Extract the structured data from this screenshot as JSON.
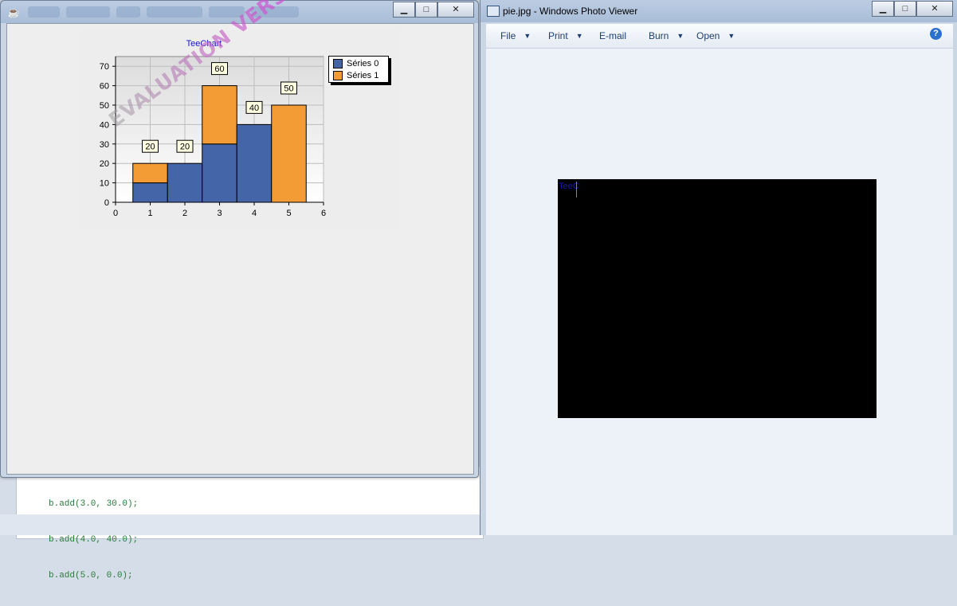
{
  "background_editor": {
    "code_lines": [
      "b.add(3.0, 30.0);",
      "b.add(4.0, 40.0);",
      "b.add(5.0, 0.0);"
    ]
  },
  "java_window": {
    "minimize_glyph": "▁",
    "maximize_glyph": "□",
    "close_glyph": "✕"
  },
  "chart": {
    "title": "TeeChart",
    "watermark": "EVALUATION VERSION",
    "legend": [
      "Séries 0",
      "Séries 1"
    ]
  },
  "chart_data": {
    "type": "bar",
    "stacked": true,
    "title": "TeeChart",
    "x": [
      1,
      2,
      3,
      4,
      5
    ],
    "series": [
      {
        "name": "Séries 0",
        "values": [
          10,
          20,
          30,
          40,
          0
        ],
        "color": "#4466a8"
      },
      {
        "name": "Séries 1",
        "values": [
          10,
          0,
          30,
          0,
          50
        ],
        "color": "#f39c35"
      }
    ],
    "mark_labels": [
      {
        "x": 1,
        "value": 20,
        "text": "20"
      },
      {
        "x": 2,
        "value": 20,
        "text": "20"
      },
      {
        "x": 3,
        "value": 60,
        "text": "60"
      },
      {
        "x": 4,
        "value": 40,
        "text": "40"
      },
      {
        "x": 5,
        "value": 50,
        "text": "50"
      }
    ],
    "xlim": [
      0,
      6
    ],
    "ylim": [
      0,
      75
    ],
    "xticks": [
      0,
      1,
      2,
      3,
      4,
      5,
      6
    ],
    "yticks": [
      0,
      10,
      20,
      30,
      40,
      50,
      60,
      70
    ],
    "grid": true,
    "legend_position": "top-right"
  },
  "photo_viewer": {
    "title": "pie.jpg - Windows Photo Viewer",
    "menu": [
      {
        "label": "File",
        "dropdown": true
      },
      {
        "label": "Print",
        "dropdown": true
      },
      {
        "label": "E-mail",
        "dropdown": false
      },
      {
        "label": "Burn",
        "dropdown": true
      },
      {
        "label": "Open",
        "dropdown": true
      }
    ],
    "help_glyph": "?",
    "photo_text": "TeeC",
    "minimize_glyph": "▁",
    "maximize_glyph": "□",
    "close_glyph": "✕"
  },
  "colors": {
    "series0": "#4466a8",
    "series1": "#f39c35",
    "title_blue": "#1717c8"
  }
}
